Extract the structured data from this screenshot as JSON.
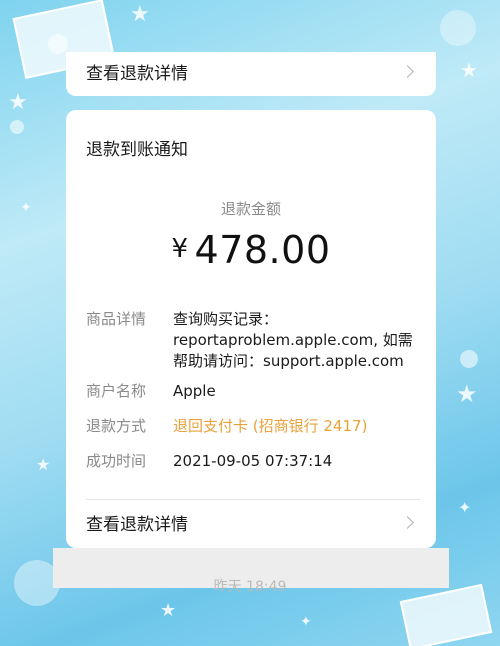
{
  "top_card": {
    "link_label": "查看退款详情"
  },
  "card": {
    "title": "退款到账通知",
    "amount_label": "退款金额",
    "currency_symbol": "¥",
    "amount": "478.00",
    "fields": [
      {
        "key": "商品详情",
        "value_line1": "查询购买记录：",
        "value_line2": "reportaproblem.apple.com, 如需",
        "value_line3": "帮助请访问：support.apple.com"
      },
      {
        "key": "商户名称",
        "value": "Apple"
      },
      {
        "key": "退款方式",
        "value": "退回支付卡 (招商银行 2417)"
      },
      {
        "key": "成功时间",
        "value": "2021-09-05 07:37:14"
      }
    ],
    "link_label": "查看退款详情"
  },
  "footer": {
    "timestamp": "昨天 18:49"
  },
  "colors": {
    "accent_orange": "#e8a23a",
    "label_gray": "#8a8a8a",
    "background": "#9fdcf2"
  },
  "icons": [
    "chevron-right-icon",
    "chevron-right-icon"
  ]
}
